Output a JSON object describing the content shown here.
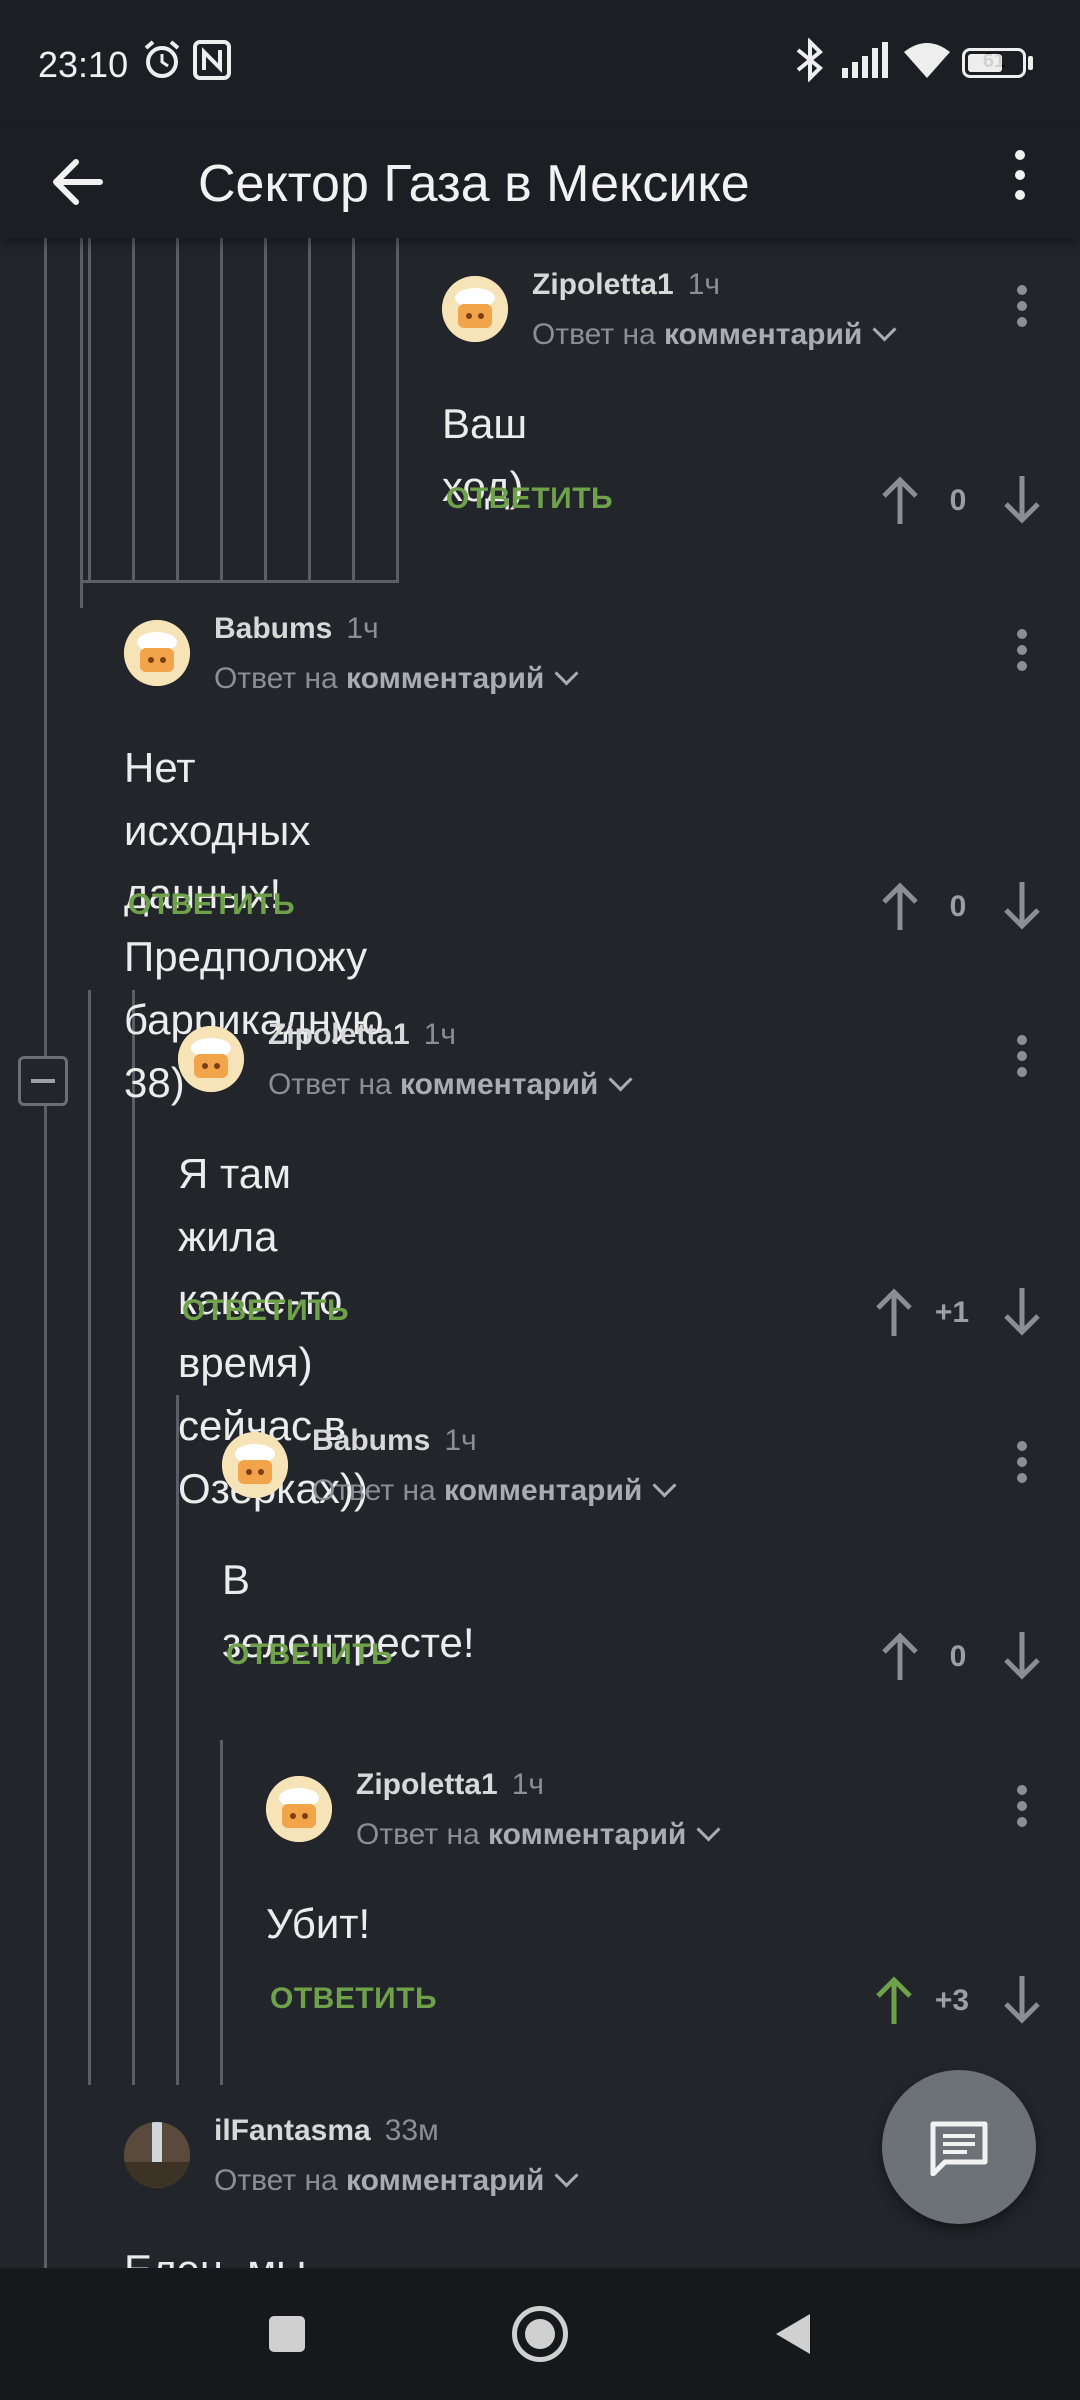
{
  "status": {
    "time": "23:10",
    "battery": "61"
  },
  "header": {
    "title": "Сектор Газа в Мексике"
  },
  "labels": {
    "reply_prefix": "Ответ на",
    "reply_target": "комментарий",
    "reply_button": "ОТВЕТИТЬ"
  },
  "comments": [
    {
      "author": "Zipoletta1",
      "time": "1ч",
      "text": "Ваш ход)",
      "votes": "0"
    },
    {
      "author": "Babums",
      "time": "1ч",
      "text": "Нет исходных данных!\nПредположу баррикадную 38)",
      "votes": "0"
    },
    {
      "author": "Zipoletta1",
      "time": "1ч",
      "text": "Я там жила какое-то время) сейчас в\nОзерках))",
      "votes": "+1"
    },
    {
      "author": "Babums",
      "time": "1ч",
      "text": "В зелентресте!",
      "votes": "0"
    },
    {
      "author": "Zipoletta1",
      "time": "1ч",
      "text": "Убит!",
      "votes": "+3"
    },
    {
      "author": "ilFantasma",
      "time": "33м",
      "text": "Елец, мы недалеко)",
      "votes": ""
    }
  ],
  "colors": {
    "accent_green": "#6fa04a",
    "background": "#22262b",
    "bar": "#1b1e22"
  }
}
